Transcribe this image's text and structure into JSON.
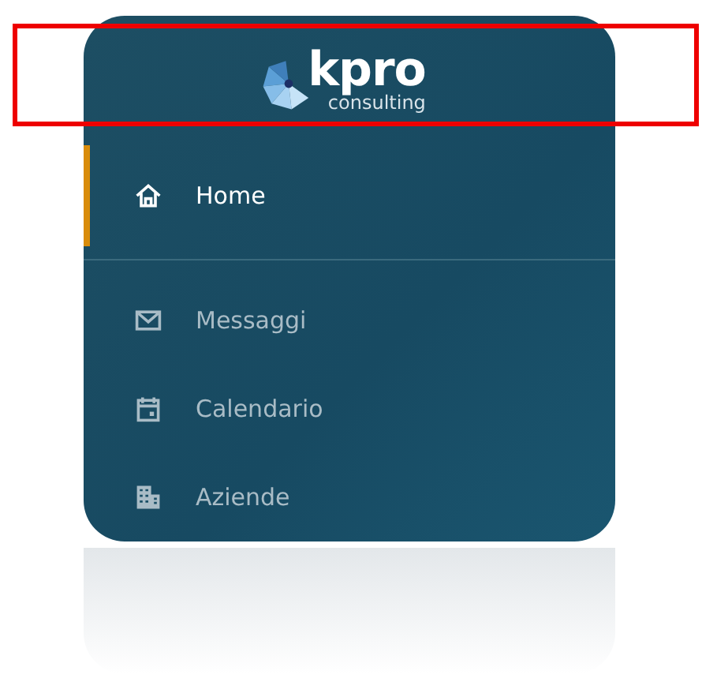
{
  "logo": {
    "name": "kpro",
    "tagline": "consulting"
  },
  "menu": [
    {
      "label": "Home",
      "selected": true
    },
    {
      "label": "Messaggi",
      "selected": false
    },
    {
      "label": "Calendario",
      "selected": false
    },
    {
      "label": "Aziende",
      "selected": false
    }
  ]
}
